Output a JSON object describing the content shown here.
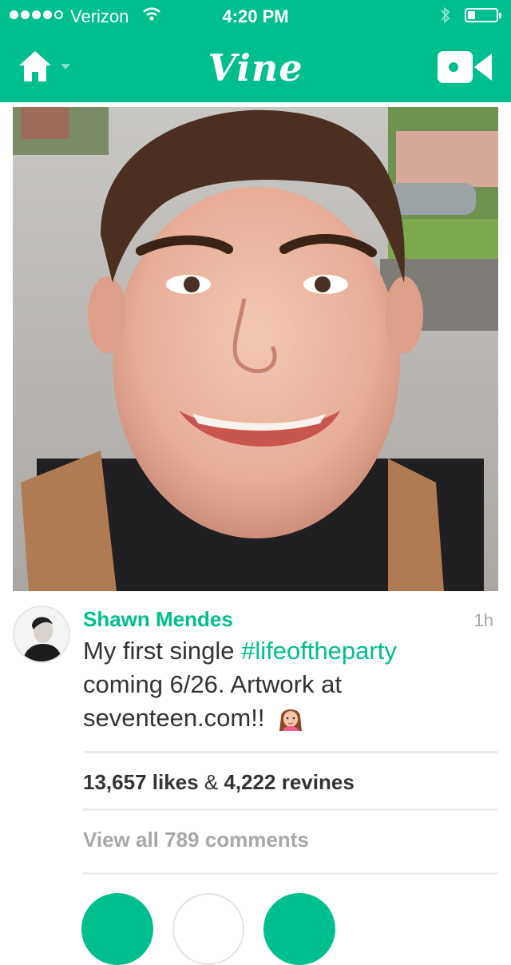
{
  "status_bar": {
    "carrier": "Verizon",
    "time": "4:20 PM",
    "signal_dots_filled": 4,
    "signal_dots_total": 5,
    "battery_level": 0.25,
    "icons": [
      "wifi-icon",
      "bluetooth-icon",
      "battery-icon"
    ]
  },
  "nav": {
    "logo_text": "Vine",
    "home_icon": "home-icon",
    "camera_icon": "video-camera-icon"
  },
  "post": {
    "author": "Shawn Mendes",
    "time": "1h",
    "caption_before": "My first single ",
    "hashtag": "#lifeoftheparty",
    "caption_after": " coming 6/26. Artwork at seventeen.com!!",
    "caption_emoji": "🙆",
    "likes": "13,657",
    "likes_label": "likes",
    "and_symbol": "&",
    "revines": "4,222",
    "revines_label": "revines",
    "view_comments": "View all 789 comments"
  },
  "colors": {
    "brand": "#00bf8f",
    "text": "#333333",
    "muted": "#a8a8a8",
    "divider": "#ececec"
  }
}
